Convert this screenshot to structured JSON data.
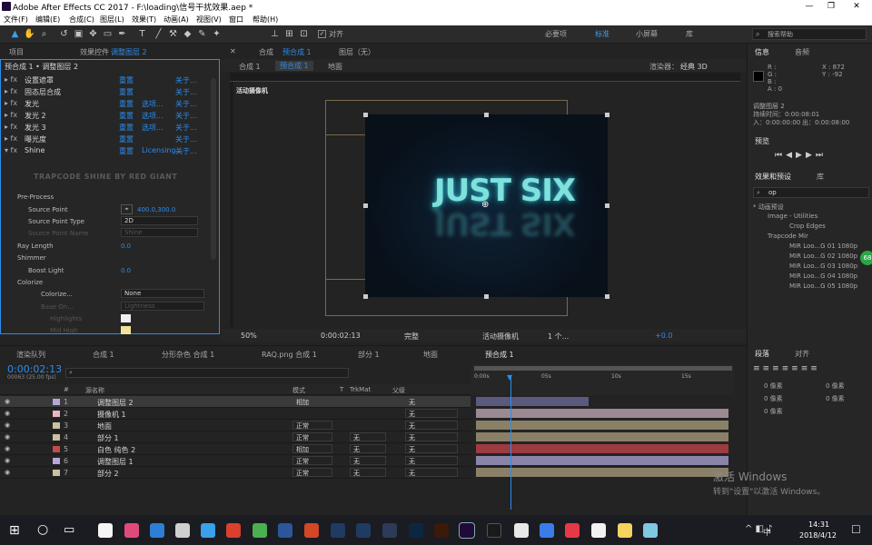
{
  "window": {
    "title": "Adobe After Effects CC 2017 - F:\\loading\\信号干扰效果.aep *",
    "min": "—",
    "max": "❐",
    "close": "✕"
  },
  "menu": [
    "文件(F)",
    "编辑(E)",
    "合成(C)",
    "图层(L)",
    "效果(T)",
    "动画(A)",
    "视图(V)",
    "窗口",
    "帮助(H)"
  ],
  "toolbar": {
    "snap_label": "对齐",
    "workspaces": [
      "必要项",
      "标准",
      "小屏幕",
      "库"
    ],
    "search_placeholder": "搜索帮助"
  },
  "project_panel": {
    "tab_project": "项目",
    "tab_effects": "效果控件",
    "effects_layer": "调整图层 2",
    "breadcrumb": "预合成 1 • 调整图层 2"
  },
  "effects": [
    {
      "name": "设置遮罩",
      "reset": "重置",
      "about": "关于..."
    },
    {
      "name": "固态层合成",
      "reset": "重置",
      "about": "关于..."
    },
    {
      "name": "发光",
      "reset": "重置",
      "options": "选项...",
      "about": "关于..."
    },
    {
      "name": "发光 2",
      "reset": "重置",
      "options": "选项...",
      "about": "关于..."
    },
    {
      "name": "发光 3",
      "reset": "重置",
      "options": "选项...",
      "about": "关于..."
    },
    {
      "name": "曝光度",
      "reset": "重置",
      "about": "关于..."
    },
    {
      "name": "Shine",
      "reset": "重置",
      "options": "Licensing...",
      "about": "关于..."
    }
  ],
  "shine": {
    "banner": "TRAPCODE SHINE BY RED GIANT",
    "pre_process": "Pre-Process",
    "source_point_label": "Source Point",
    "source_point_value": "400.0,300.0",
    "source_point_type_label": "Source Point Type",
    "source_point_type_value": "2D",
    "source_point_name_label": "Source Point Name",
    "source_point_name_value": "Shine",
    "ray_length_label": "Ray Length",
    "ray_length_value": "0.0",
    "shimmer": "Shimmer",
    "boost_light_label": "Boost Light",
    "boost_light_value": "0.0",
    "colorize": "Colorize",
    "colorize_sub_label": "Colorize...",
    "colorize_sub_value": "None",
    "base_on_label": "Base On...",
    "base_on_value": "Lightness",
    "highlights": "Highlights",
    "mid_high": "Mid High"
  },
  "comp_panel": {
    "tab": "合成",
    "comp_name": "预合成 1",
    "layer_tab": "图层（无）",
    "nav": [
      "合成 1",
      "预合成 1",
      "地面"
    ],
    "renderer_label": "渲染器：",
    "renderer_value": "经典 3D",
    "camera_label": "活动摄像机",
    "title_text": "JUST SIX"
  },
  "comp_footer": {
    "zoom": "50%",
    "timecode": "0:00:02:13",
    "quality": "完整",
    "camera": "活动摄像机",
    "views": "1 个...",
    "exposure": "+0.0"
  },
  "info_panel": {
    "tab_info": "信息",
    "tab_audio": "音频",
    "rgba": [
      "R :",
      "G :",
      "B :",
      "A : 0"
    ],
    "x": "X : 872",
    "y": "Y : -92",
    "layer": "调整图层 2",
    "dur": "持续时间：0:00:08:01",
    "in": "入：0:00:00:00",
    "out": "出：0:00:08:00"
  },
  "preview_panel": {
    "tab": "预览"
  },
  "effects_presets": {
    "tab": "效果和预设",
    "tab2": "库",
    "search": "op",
    "items": [
      "* 动画预设",
      "Image - Utilities",
      "Crop Edges",
      "Trapcode Mir",
      "MIR Loo...G 01 1080p",
      "MIR Loo...G 02 1080p",
      "MIR Loo...G 03 1080p",
      "MIR Loo...G 04 1080p",
      "MIR Loo...G 05 1080p"
    ]
  },
  "paragraph_panel": {
    "tab": "段落",
    "tab2": "对齐",
    "px": "0 像素",
    "px2": "0 像素",
    "px3": "0 像素",
    "px4": "0 像素",
    "px5": "0 像素"
  },
  "timeline": {
    "tabs": [
      "渲染队列",
      "合成 1",
      "分形杂色 合成 1",
      "RAQ.png 合成 1",
      "部分 1",
      "地面",
      "预合成 1"
    ],
    "timecode": "0:00:02:13",
    "frames": "00063 (25.00 fps)",
    "col_num": "#",
    "col_name": "源名称",
    "col_mode": "模式",
    "col_t": "T",
    "col_trk": "TrkMat",
    "col_parent": "父级",
    "ruler": [
      "0:00s",
      "05s",
      "10s",
      "15s"
    ],
    "layers": [
      {
        "num": "1",
        "name": "调整图层 2",
        "mode": "相加",
        "trk": "",
        "parent": "无",
        "color": "#b7a6d9",
        "bar": "#5a5a7e"
      },
      {
        "num": "2",
        "name": "摄像机 1",
        "mode": "",
        "trk": "",
        "parent": "无",
        "color": "#e9b5c6",
        "bar": "#9b8a93"
      },
      {
        "num": "3",
        "name": "地面",
        "mode": "正常",
        "trk": "",
        "parent": "无",
        "color": "#c9c1a0",
        "bar": "#8a8068"
      },
      {
        "num": "4",
        "name": "部分 1",
        "mode": "正常",
        "trk": "无",
        "parent": "无",
        "color": "#c9c1a0",
        "bar": "#8a8068"
      },
      {
        "num": "5",
        "name": "白色 纯色 2",
        "mode": "相加",
        "trk": "无",
        "parent": "无",
        "color": "#c64a4a",
        "bar": "#9c3b40"
      },
      {
        "num": "6",
        "name": "调整图层 1",
        "mode": "正常",
        "trk": "无",
        "parent": "无",
        "color": "#b7a6d9",
        "bar": "#8a84a8"
      },
      {
        "num": "7",
        "name": "部分 2",
        "mode": "正常",
        "trk": "无",
        "parent": "无",
        "color": "#c9c1a0",
        "bar": "#8a8068"
      }
    ]
  },
  "watermark": {
    "line1": "激活 Windows",
    "line2": "转到\"设置\"以激活 Windows。"
  },
  "taskbar": {
    "time": "14:31",
    "date": "2018/4/12",
    "ime": "中",
    "badge": "68"
  }
}
